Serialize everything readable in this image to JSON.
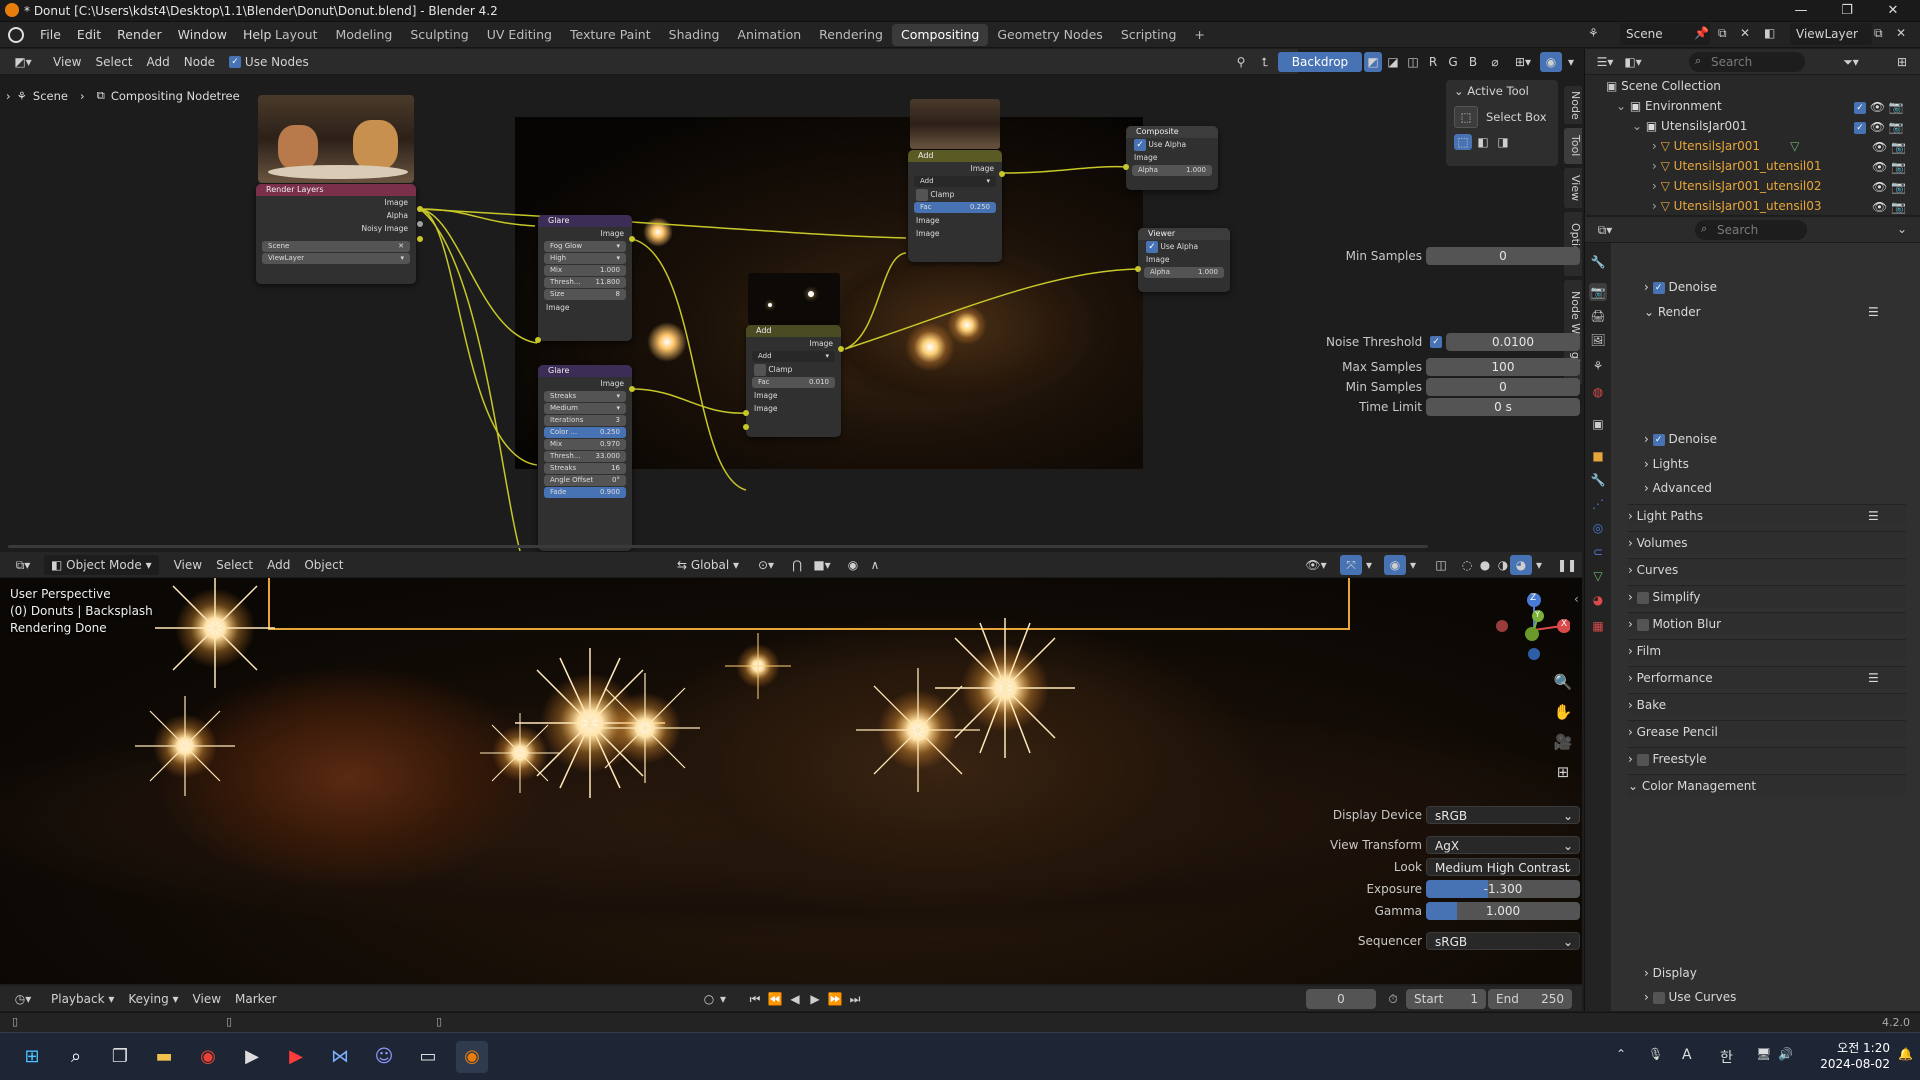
{
  "window": {
    "title": "* Donut [C:\\Users\\kdst4\\Desktop\\1.1\\Blender\\Donut\\Donut.blend] - Blender 4.2"
  },
  "menus": [
    "File",
    "Edit",
    "Render",
    "Window",
    "Help"
  ],
  "workspaces": [
    "Layout",
    "Modeling",
    "Sculpting",
    "UV Editing",
    "Texture Paint",
    "Shading",
    "Animation",
    "Rendering",
    "Compositing",
    "Geometry Nodes",
    "Scripting"
  ],
  "active_workspace": "Compositing",
  "scene_selector": {
    "scene": "Scene",
    "view_layer": "ViewLayer"
  },
  "node_editor": {
    "menu": [
      "View",
      "Select",
      "Add",
      "Node"
    ],
    "use_nodes_label": "Use Nodes",
    "backdrop_label": "Backdrop",
    "channel_buttons": [
      "R",
      "G",
      "B"
    ],
    "breadcrumb": [
      "Scene",
      "Compositing Nodetree"
    ],
    "sidebar_tabs": [
      "Node",
      "Tool",
      "View",
      "Options",
      "Node Wrangler"
    ],
    "active_tool_title": "Active Tool",
    "active_tool_name": "Select Box",
    "nodes": {
      "render_layers": {
        "title": "Render Layers",
        "outputs": [
          "Image",
          "Alpha",
          "Noisy Image"
        ],
        "scene": "Scene",
        "view_layer": "ViewLayer"
      },
      "glare1": {
        "title": "Glare",
        "output": "Image",
        "type": "Fog Glow",
        "quality": "High",
        "mix_label": "Mix",
        "mix": "1.000",
        "thresh_label": "Thresh...",
        "thresh": "11.800",
        "size_label": "Size",
        "size": "8",
        "input": "Image"
      },
      "glare2": {
        "title": "Glare",
        "output": "Image",
        "type": "Streaks",
        "quality": "Medium",
        "iter_label": "Iterations",
        "iter": "3",
        "color_label": "Color ...",
        "color": "0.250",
        "mix_label": "Mix",
        "mix": "0.970",
        "thresh_label": "Thresh...",
        "thresh": "33.000",
        "streaks_label": "Streaks",
        "streaks": "16",
        "angle_label": "Angle Offset",
        "angle": "0°",
        "fade_label": "Fade",
        "fade": "0.900"
      },
      "add_small": {
        "title": "Add",
        "output": "Image",
        "blend": "Add",
        "clamp": "Clamp",
        "fac_label": "Fac",
        "fac": "0.010",
        "inputs": [
          "Image",
          "Image"
        ]
      },
      "add_top": {
        "title": "Add",
        "output": "Image",
        "blend": "Add",
        "clamp": "Clamp",
        "fac_label": "Fac",
        "fac": "0.250",
        "inputs": [
          "Image",
          "Image"
        ]
      },
      "composite": {
        "title": "Composite",
        "use_alpha": "Use Alpha",
        "input": "Image",
        "alpha_label": "Alpha",
        "alpha": "1.000"
      },
      "viewer": {
        "title": "Viewer",
        "use_alpha": "Use Alpha",
        "input": "Image",
        "alpha_label": "Alpha",
        "alpha": "1.000"
      }
    }
  },
  "viewport": {
    "mode": "Object Mode",
    "menu": [
      "View",
      "Select",
      "Add",
      "Object"
    ],
    "transform": "Global",
    "info": [
      "User Perspective",
      "(0) Donuts | Backsplash",
      "Rendering Done"
    ],
    "gizmo": {
      "x": "X",
      "y": "Y",
      "z": "Z"
    }
  },
  "timeline": {
    "menu": [
      "Playback",
      "Keying",
      "View",
      "Marker"
    ],
    "current_frame": "0",
    "start_label": "Start",
    "start": "1",
    "end_label": "End",
    "end": "250"
  },
  "outliner": {
    "search_placeholder": "Search",
    "rows": [
      {
        "label": "Scene Collection",
        "depth": 0
      },
      {
        "label": "Environment",
        "depth": 1
      },
      {
        "label": "UtensilsJar001",
        "depth": 2
      },
      {
        "label": "UtensilsJar001",
        "depth": 3
      },
      {
        "label": "UtensilsJar001_utensil01",
        "depth": 3
      },
      {
        "label": "UtensilsJar001_utensil02",
        "depth": 3
      },
      {
        "label": "UtensilsJar001_utensil03",
        "depth": 3
      }
    ]
  },
  "properties": {
    "search_placeholder": "Search",
    "min_samples_top_label": "Min Samples",
    "min_samples_top": "0",
    "denoise1": "Denoise",
    "render_section": "Render",
    "noise_threshold_label": "Noise Threshold",
    "noise_threshold": "0.0100",
    "max_samples_label": "Max Samples",
    "max_samples": "100",
    "min_samples_label": "Min Samples",
    "min_samples": "0",
    "time_limit_label": "Time Limit",
    "time_limit": "0 s",
    "denoise2": "Denoise",
    "lights": "Lights",
    "advanced": "Advanced",
    "sections": [
      "Light Paths",
      "Volumes",
      "Curves",
      "Simplify",
      "Motion Blur",
      "Film",
      "Performance",
      "Bake",
      "Grease Pencil",
      "Freestyle",
      "Color Management"
    ],
    "display_device_label": "Display Device",
    "display_device": "sRGB",
    "view_transform_label": "View Transform",
    "view_transform": "AgX",
    "look_label": "Look",
    "look": "Medium High Contrast",
    "exposure_label": "Exposure",
    "exposure": "-1.300",
    "gamma_label": "Gamma",
    "gamma": "1.000",
    "sequencer_label": "Sequencer",
    "sequencer": "sRGB",
    "display": "Display",
    "use_curves": "Use Curves"
  },
  "statusbar": {
    "version": "4.2.0"
  },
  "taskbar": {
    "time": "오전 1:20",
    "date": "2024-08-02",
    "ime": "A",
    "ime2": "한"
  }
}
